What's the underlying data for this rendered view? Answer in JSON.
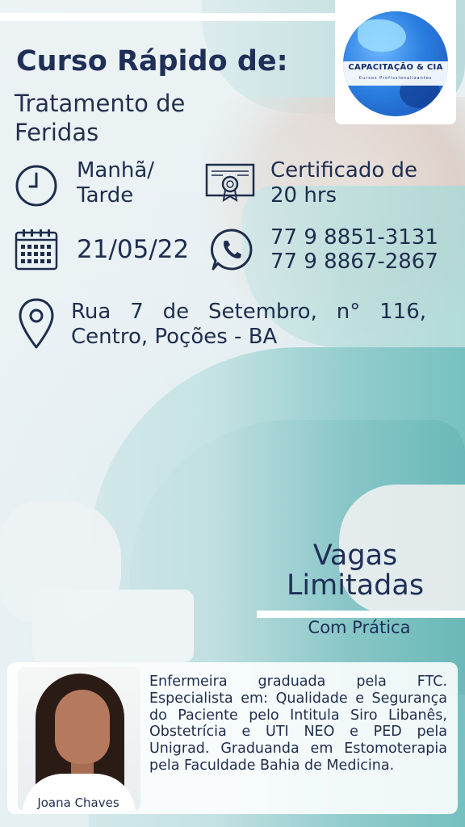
{
  "logo": {
    "title": "CAPACITAÇÃO & CIA",
    "subtitle": "Cursos Profissionalizantes"
  },
  "header": {
    "title": "Curso Rápido de:",
    "subtitle": "Tratamento de Feridas"
  },
  "info": {
    "schedule": "Manhã/ Tarde",
    "certificate": "Certificado de 20 hrs",
    "date": "21/05/22",
    "phone_1": "77 9 8851-3131",
    "phone_2": "77 9 8867-2867",
    "address_line_1": "Rua 7 de Setembro, n° 116,",
    "address_line_2": "Centro, Poções - BA"
  },
  "offer": {
    "headline_1": "Vagas",
    "headline_2": "Limitadas",
    "note": "Com Prática"
  },
  "instructor": {
    "name": "Joana Chaves",
    "bio": "Enfermeira graduada pela FTC. Especialista em: Qualidade e Segurança do Paciente pelo Intitula Siro Libanês, Obstetrícia e UTI NEO e PED pela Unigrad. Graduanda em Estomoterapia pela Faculdade Bahia de Medicina."
  },
  "icons": [
    "clock-icon",
    "certificate-icon",
    "calendar-icon",
    "whatsapp-icon",
    "location-pin-icon"
  ],
  "colors": {
    "text": "#1f2d4d",
    "scrubs": "#57b3b2",
    "logo_blue": "#2a7fe0"
  }
}
